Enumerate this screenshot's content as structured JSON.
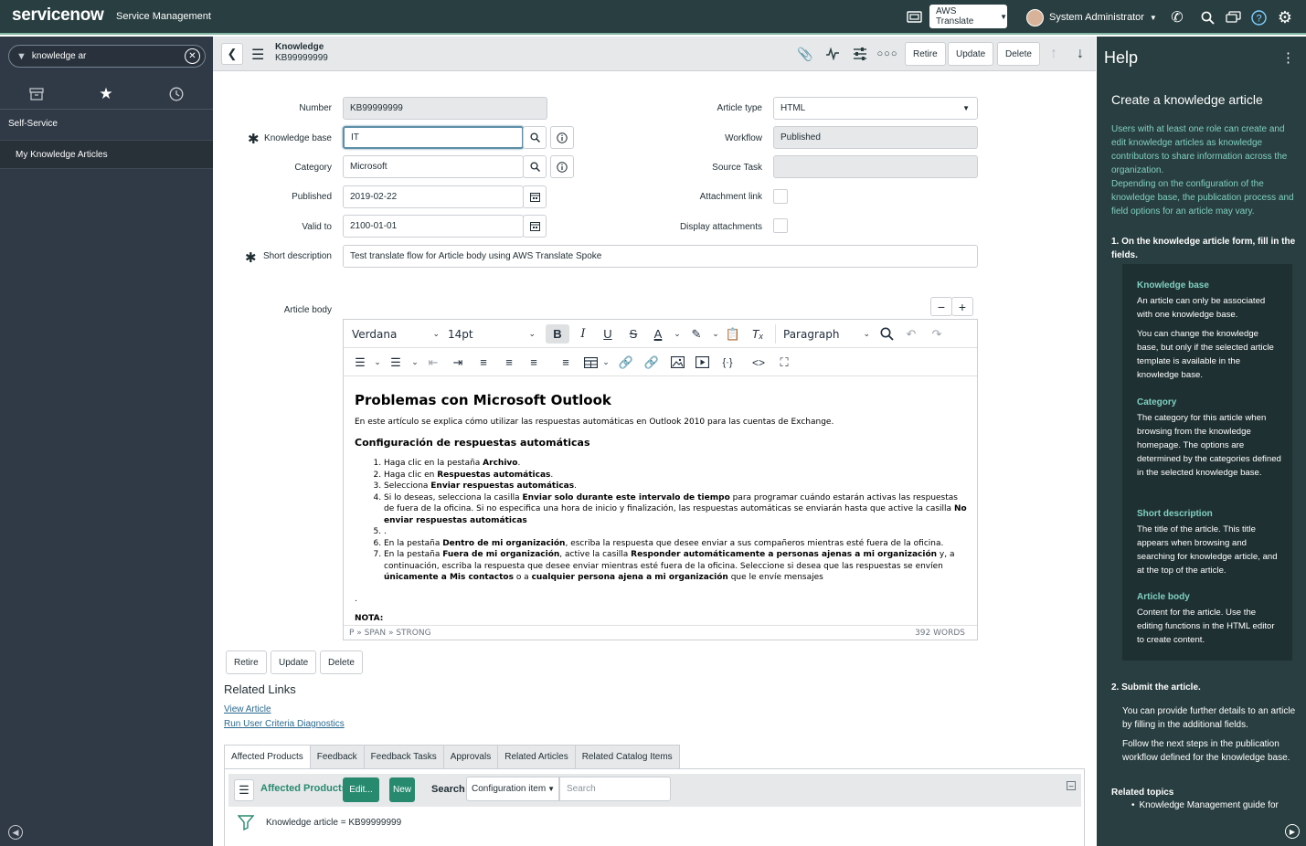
{
  "banner": {
    "logo": "servicenow",
    "subtitle": "Service Management",
    "language": "AWS Translate",
    "user": "System Administrator",
    "icons": [
      "window-icon",
      "phone-icon",
      "search-icon",
      "chat-icon",
      "help-icon",
      "gear-icon"
    ]
  },
  "nav": {
    "filter_value": "knowledge ar",
    "section": "Self-Service",
    "item": "My Knowledge Articles"
  },
  "header": {
    "title": "Knowledge",
    "number": "KB99999999",
    "buttons": {
      "retire": "Retire",
      "update": "Update",
      "delete": "Delete"
    }
  },
  "form": {
    "number_label": "Number",
    "number_value": "KB99999999",
    "kb_label": "Knowledge base",
    "kb_value": "IT",
    "category_label": "Category",
    "category_value": "Microsoft",
    "published_label": "Published",
    "published_value": "2019-02-22",
    "valid_label": "Valid to",
    "valid_value": "2100-01-01",
    "short_label": "Short description",
    "short_value": "Test translate flow for Article body using AWS Translate Spoke",
    "type_label": "Article type",
    "type_value": "HTML",
    "workflow_label": "Workflow",
    "workflow_value": "Published",
    "source_label": "Source Task",
    "source_value": "",
    "attach_link_label": "Attachment link",
    "display_attach_label": "Display attachments",
    "body_label": "Article body"
  },
  "editor": {
    "font": "Verdana",
    "size": "14pt",
    "block": "Paragraph",
    "path": "P » SPAN » STRONG",
    "words": "392 WORDS",
    "h1": "Problemas con Microsoft Outlook",
    "intro": "En este artículo se explica cómo utilizar las respuestas automáticas en Outlook 2010 para las cuentas de Exchange.",
    "h3": "Configuración de respuestas automáticas",
    "dot": ".",
    "nota": "NOTA:"
  },
  "bottom": {
    "retire": "Retire",
    "update": "Update",
    "delete": "Delete",
    "related_links": "Related Links",
    "view_article": "View Article",
    "run_diag": "Run User Criteria Diagnostics",
    "tabs": [
      "Affected Products",
      "Feedback",
      "Feedback Tasks",
      "Approvals",
      "Related Articles",
      "Related Catalog Items"
    ],
    "list_title": "Affected Products",
    "edit": "Edit...",
    "new": "New",
    "search_label": "Search",
    "search_field": "Configuration item",
    "search_placeholder": "Search",
    "filter": "Knowledge article = KB99999999"
  },
  "help": {
    "header": "Help",
    "title": "Create a knowledge article",
    "intro": "Users with at least one role can create and edit knowledge articles as knowledge contributors to share information across the organization.\nDepending on the configuration of the knowledge base, the publication process and field options for an article may vary.",
    "step1": "1. On the knowledge article form, fill in the fields.",
    "kb_t": "Knowledge base",
    "kb_d1": "An article can only be associated with one knowledge base.",
    "kb_d2": "You can change the knowledge base, but only if the selected article template is available in the knowledge base.",
    "cat_t": "Category",
    "cat_d": "The category for this article when browsing from the knowledge homepage. The options are determined by the categories defined in the selected knowledge base.",
    "sd_t": "Short description",
    "sd_d": "The title of the article. This title appears when browsing and searching for knowledge article, and at the top of the article.",
    "ab_t": "Article body",
    "ab_d": "Content for the article. Use the editing functions in the HTML editor to create content.",
    "step2": "2. Submit the article.",
    "s2_d1": "You can provide further details to an article by filling in the additional fields.",
    "s2_d2": "Follow the next steps in the publication workflow defined for the knowledge base.",
    "related": "Related topics",
    "related_item": "Knowledge Management guide for"
  }
}
